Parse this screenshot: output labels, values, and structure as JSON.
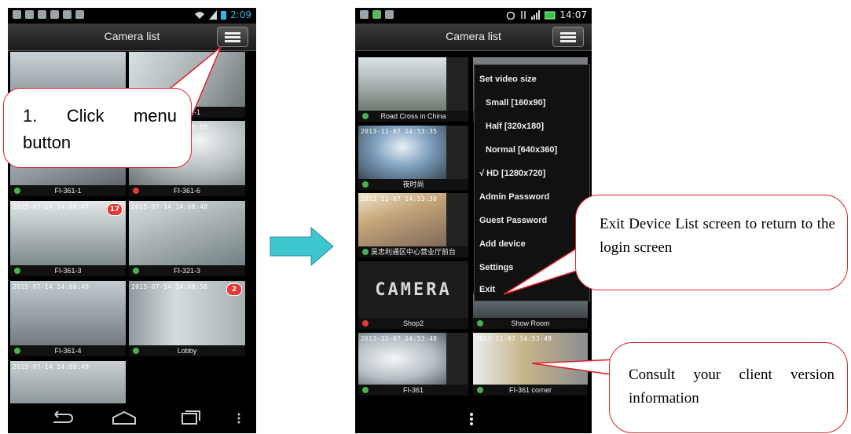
{
  "left_phone": {
    "status_time": "2:09",
    "title": "Camera list",
    "tiles": [
      {
        "caption": "",
        "timestamp": "",
        "badge": ""
      },
      {
        "caption": "FI-321-1",
        "timestamp": "",
        "badge": ""
      },
      {
        "caption": "FI-361-1",
        "timestamp": "",
        "badge": ""
      },
      {
        "caption": "FI-361-6",
        "timestamp": "2015-07-14 14:08:00",
        "badge": ""
      },
      {
        "caption": "FI-361-3",
        "timestamp": "2015-07-14 14:08:47",
        "badge": "17"
      },
      {
        "caption": "FI-321-3",
        "timestamp": "2015-07-14 14:08:48",
        "badge": ""
      },
      {
        "caption": "FI-361-4",
        "timestamp": "2015-07-14 14:08:49",
        "badge": ""
      },
      {
        "caption": "Lobby",
        "timestamp": "2015-07-14 14:08:50",
        "badge": "2"
      },
      {
        "caption": "",
        "timestamp": "2015-07-14 14:08:49",
        "badge": ""
      }
    ]
  },
  "right_phone": {
    "status_time": "14:07",
    "title": "Camera list",
    "tiles": [
      {
        "caption": "Road Cross in China",
        "timestamp": ""
      },
      {
        "caption": "夜时尚",
        "timestamp": "2013-11-07 14:53:35"
      },
      {
        "caption": "吴忠利通区中心营业厅前台",
        "timestamp": "2013-11-07 14:53:30"
      },
      {
        "caption": "Shop2",
        "logo": "CAMERA"
      },
      {
        "caption": "Show Room",
        "timestamp": ""
      },
      {
        "caption": "FI-361",
        "timestamp": "2013-11-07 14:53:48"
      },
      {
        "caption": "FI-361 corner",
        "timestamp": "2013-11-07 14:53:49"
      }
    ],
    "menu": {
      "header": "Set video size",
      "items": [
        "Small [160x90]",
        "Half [320x180]",
        "Normal [640x360]",
        "√ HD [1280x720]",
        "Admin Password",
        "Guest Password",
        "Add device",
        "Settings",
        "Exit"
      ]
    }
  },
  "callouts": {
    "click_menu": "1. Click menu button",
    "exit": "Exit Device List screen to return to the login screen",
    "consult": "Consult your client version information"
  },
  "colors": {
    "online_dot": "#4caf50",
    "offline_dot": "#e53935",
    "arrow": "#3ec6cf",
    "callout_border": "#e0212a"
  }
}
